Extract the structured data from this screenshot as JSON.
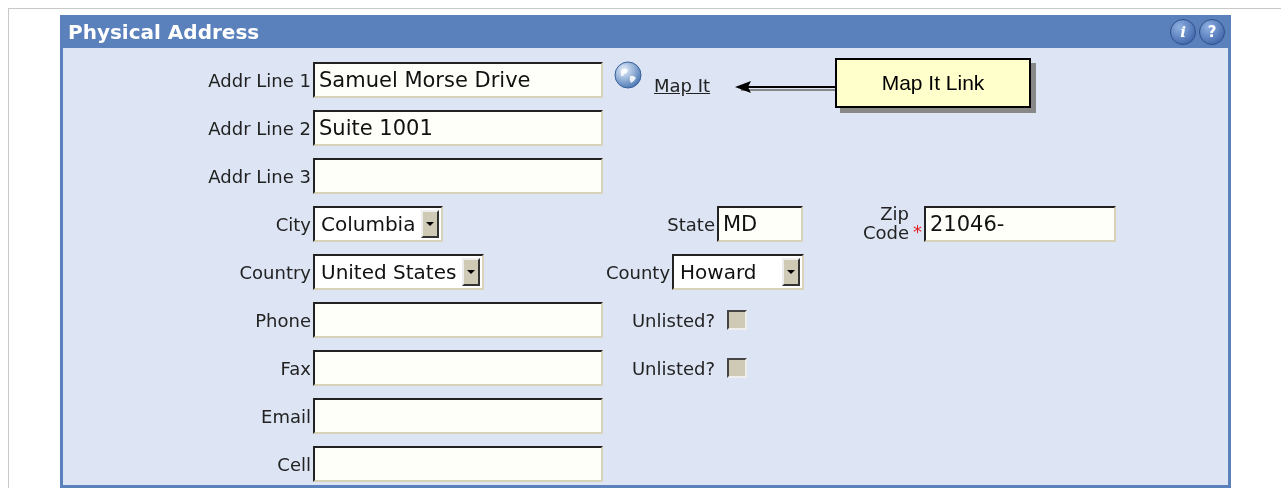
{
  "panel": {
    "title": "Physical Address",
    "header_buttons": [
      {
        "kind": "info",
        "text": "i"
      },
      {
        "kind": "help",
        "text": "?"
      }
    ]
  },
  "rows": [
    {
      "cells": [
        {
          "kind": "text",
          "label": "Addr Line 1",
          "value": "Samuel Morse Drive"
        },
        {
          "kind": "link",
          "text": "Map It"
        }
      ]
    },
    {
      "cells": [
        {
          "kind": "text",
          "label": "Addr Line 2",
          "value": "Suite 1001"
        }
      ]
    },
    {
      "cells": [
        {
          "kind": "text",
          "label": "Addr Line 3"
        }
      ]
    },
    {
      "cells": [
        {
          "kind": "select",
          "label": "City",
          "value": "Columbia"
        },
        {
          "kind": "short",
          "label": "State",
          "value": "MD"
        },
        {
          "kind": "text",
          "label": "Zip Code",
          "value": "21046-",
          "required_mark": "*"
        }
      ]
    },
    {
      "cells": [
        {
          "kind": "select",
          "label": "Country",
          "value": "United States"
        },
        {
          "kind": "select",
          "label": "County",
          "value": "Howard"
        }
      ]
    },
    {
      "cells": [
        {
          "kind": "text",
          "label": "Phone"
        },
        {
          "kind": "checkbox",
          "label": "Unlisted?",
          "checked": false
        }
      ]
    },
    {
      "cells": [
        {
          "kind": "text",
          "label": "Fax"
        },
        {
          "kind": "checkbox",
          "label": "Unlisted?",
          "checked": false
        }
      ]
    },
    {
      "cells": [
        {
          "kind": "text",
          "label": "Email"
        }
      ]
    },
    {
      "cells": [
        {
          "kind": "text",
          "label": "Cell"
        }
      ]
    }
  ],
  "callout": {
    "text": "Map It Link"
  }
}
